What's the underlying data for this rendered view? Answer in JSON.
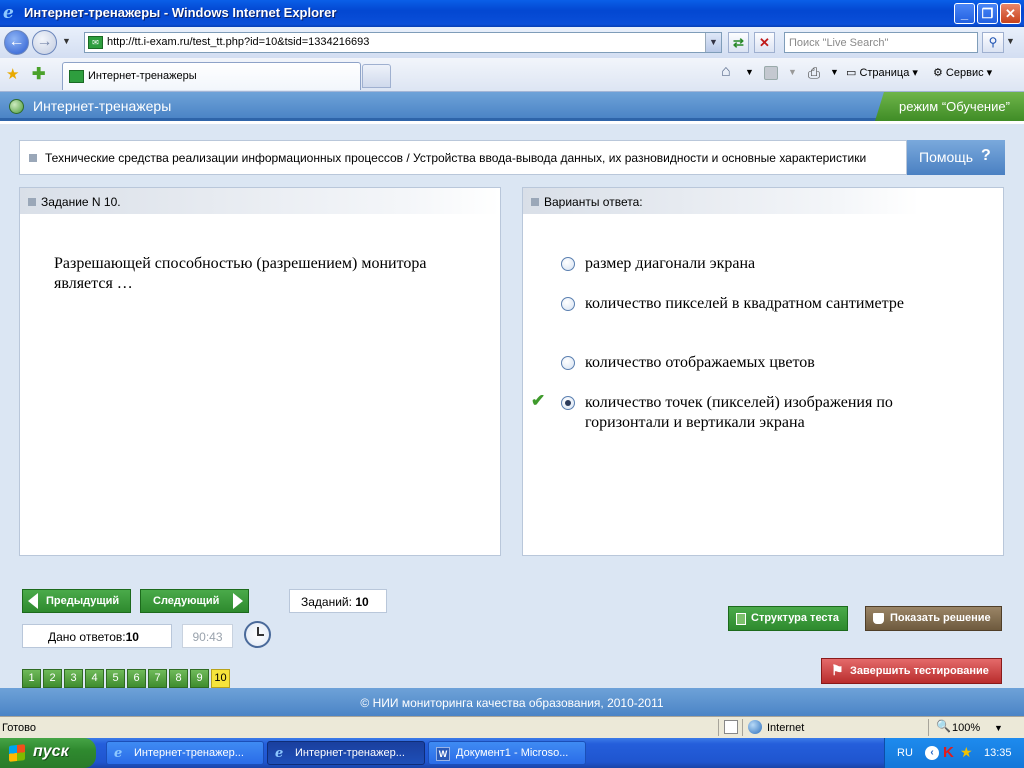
{
  "window": {
    "title": "Интернет-тренажеры - Windows Internet Explorer",
    "minimize": "_",
    "maximize": "❐",
    "close": "✕"
  },
  "browser": {
    "address": "http://tt.i-exam.ru/test_tt.php?id=10&tsid=1334216693",
    "search_placeholder": "Поиск \"Live Search\"",
    "tab_label": "Интернет-тренажеры",
    "page_menu": "Страница",
    "tools_menu": "Сервис"
  },
  "app": {
    "title": "Интернет-тренажеры",
    "mode": "режим “Обучение”",
    "topic": "Технические средства реализации информационных процессов / Устройства ввода-вывода данных, их разновидности и основные характеристики",
    "help_label": "Помощь",
    "help_icon": "?",
    "question_header": "Задание N 10.",
    "answers_header": "Варианты ответа:",
    "question_text": "Разрешающей способностью (разрешением) монитора является …",
    "options": [
      {
        "text": "размер диагонали экрана",
        "selected": false,
        "correct": false
      },
      {
        "text": "количество пикселей в квадратном сантиметре",
        "selected": false,
        "correct": false
      },
      {
        "text": "количество отображаемых цветов",
        "selected": false,
        "correct": false
      },
      {
        "text": "количество точек (пикселей) изображения по горизонтали и вертикали экрана",
        "selected": true,
        "correct": true
      }
    ],
    "prev_label": "Предыдущий",
    "next_label": "Следующий",
    "tasks_label": "Заданий:",
    "tasks_count": "10",
    "answered_label": "Дано ответов:",
    "answered_count": "10",
    "timer": "90:43",
    "pages": [
      "1",
      "2",
      "3",
      "4",
      "5",
      "6",
      "7",
      "8",
      "9",
      "10"
    ],
    "current_page": "10",
    "structure_label": "Структура теста",
    "solution_label": "Показать решение",
    "finish_label": "Завершить тестирование",
    "footer": "© НИИ мониторинга качества образования, 2010-2011"
  },
  "status": {
    "ready": "Готово",
    "zone": "Internet",
    "zoom": "100%"
  },
  "taskbar": {
    "start": "пуск",
    "tasks": [
      {
        "label": "Интернет-тренажер...",
        "active": false,
        "icon": "ie-icon"
      },
      {
        "label": "Интернет-тренажер...",
        "active": true,
        "icon": "ie-icon"
      },
      {
        "label": "Документ1 - Microso...",
        "active": false,
        "icon": "word-icon"
      }
    ],
    "lang": "RU",
    "time": "13:35"
  },
  "colors": {
    "accent_blue": "#4b84c6",
    "mode_green": "#3f8c26",
    "button_green": "#2e8a2e",
    "finish_red": "#b92d2d",
    "current_page_yellow": "#f6e43a"
  }
}
